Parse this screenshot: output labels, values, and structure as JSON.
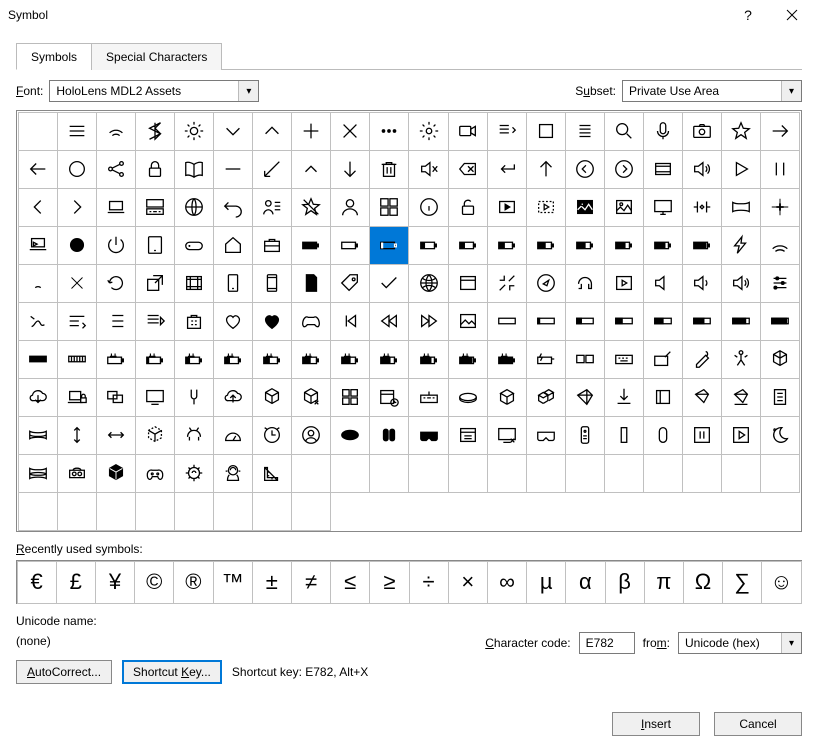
{
  "window": {
    "title": "Symbol"
  },
  "tabs": {
    "symbols": "Symbols",
    "special": "Special Characters"
  },
  "font": {
    "label": "Font:",
    "value": "HoloLens MDL2 Assets"
  },
  "subset": {
    "label": "Subset:",
    "value": "Private Use Area"
  },
  "grid": {
    "cols": 20,
    "rows": 11,
    "selected_index": 69,
    "cells_in_last_row": 8,
    "icons": [
      "blank",
      "three-lines",
      "wifi-partial",
      "bluetooth",
      "brightness",
      "chevron-down",
      "chevron-up",
      "plus",
      "x",
      "more-dots",
      "gear",
      "video-cam",
      "list-down",
      "square",
      "list-lines",
      "magnify",
      "microphone",
      "camera",
      "star",
      "arrow-right",
      "arrow-left",
      "circle",
      "share-nodes",
      "lock",
      "open-book",
      "minus",
      "arrow-in",
      "caret-up",
      "arrow-down",
      "trash",
      "mute",
      "backspace",
      "return",
      "arrow-up",
      "circle-left",
      "circle-right",
      "slides",
      "sound",
      "play",
      "pause",
      "chevron-left",
      "chevron-right",
      "laptop",
      "keyboard-screen",
      "globe-grid",
      "undo",
      "person-list",
      "star-off",
      "person-outline",
      "windows-logo",
      "info",
      "unlock",
      "play-in-box",
      "play-box-dashed",
      "picture-filled",
      "picture-outline",
      "screen",
      "resize-h",
      "panorama",
      "plus-center",
      "laptop-cast",
      "filled-circle",
      "power",
      "tablet",
      "game-controller",
      "home",
      "briefcase",
      "battery-100",
      "battery-0",
      "battery-10",
      "battery-20",
      "battery-30",
      "battery-40",
      "battery-50",
      "battery-60",
      "battery-70",
      "battery-80",
      "battery-90",
      "bolt",
      "wifi-curve",
      "wifi-low",
      "x-thin",
      "refresh",
      "share-box",
      "filmstrip",
      "phone",
      "phone-portrait",
      "sd-card",
      "tag",
      "checkmark",
      "globe",
      "window",
      "shrink",
      "compass",
      "headset",
      "tablet-play",
      "speaker-low",
      "speaker-high",
      "speaker-max",
      "sliders",
      "hand-draw",
      "menu-caret",
      "list-indented",
      "list-play",
      "windows-store",
      "heart-outline",
      "heart-filled",
      "xbox-controller",
      "skip-back",
      "rewind",
      "fast-forward",
      "image-outline",
      "bar-empty",
      "bar-10",
      "bar-20",
      "bar-30",
      "bar-40",
      "bar-50",
      "bar-60",
      "bar-70",
      "bar-full",
      "bar-stripes",
      "plug-0",
      "plug-10",
      "plug-20",
      "plug-30",
      "plug-40",
      "plug-50",
      "plug-60",
      "plug-70",
      "plug-80",
      "plug-90",
      "plug-100",
      "plug-bolt",
      "keyboard-split",
      "keyboard",
      "pen-tablet",
      "pen-hand",
      "body-nodes",
      "cube-nodes",
      "cloud-arrow",
      "lock-pc",
      "monitors",
      "screen-big",
      "tuning-fork",
      "cloud-up",
      "cube",
      "cube-x",
      "grid-4",
      "calendar-clock",
      "keyboard-ext",
      "disc",
      "box-3d",
      "boxes",
      "kite",
      "download",
      "square-bracket",
      "kite2",
      "kite-pad",
      "receipt",
      "pano-stack",
      "move-v",
      "move-h",
      "cube-dash",
      "dog",
      "odometer",
      "time-recur",
      "person-round",
      "oval-filled",
      "clips",
      "goggles-filled",
      "window-list",
      "screen-x",
      "goggles-outline",
      "remote",
      "column",
      "pill",
      "pause-box",
      "play-box",
      "moon-sparkle",
      "pano-layers",
      "vr-headset",
      "cube-solid",
      "controller-grip",
      "brain-chip",
      "astronaut",
      "ruler-angle"
    ]
  },
  "recent": {
    "label": "Recently used symbols:",
    "items": [
      "€",
      "£",
      "¥",
      "©",
      "®",
      "™",
      "±",
      "≠",
      "≤",
      "≥",
      "÷",
      "×",
      "∞",
      "µ",
      "α",
      "β",
      "π",
      "Ω",
      "∑",
      "☺"
    ]
  },
  "unicode": {
    "label": "Unicode name:",
    "value": "(none)"
  },
  "charcode": {
    "label": "Character code:",
    "value": "E782"
  },
  "from": {
    "label": "from:",
    "value": "Unicode (hex)"
  },
  "buttons": {
    "autocorrect": "AutoCorrect...",
    "shortcutkey": "Shortcut Key...",
    "shortcut_desc": "Shortcut key: E782, Alt+X",
    "insert": "Insert",
    "cancel": "Cancel"
  }
}
